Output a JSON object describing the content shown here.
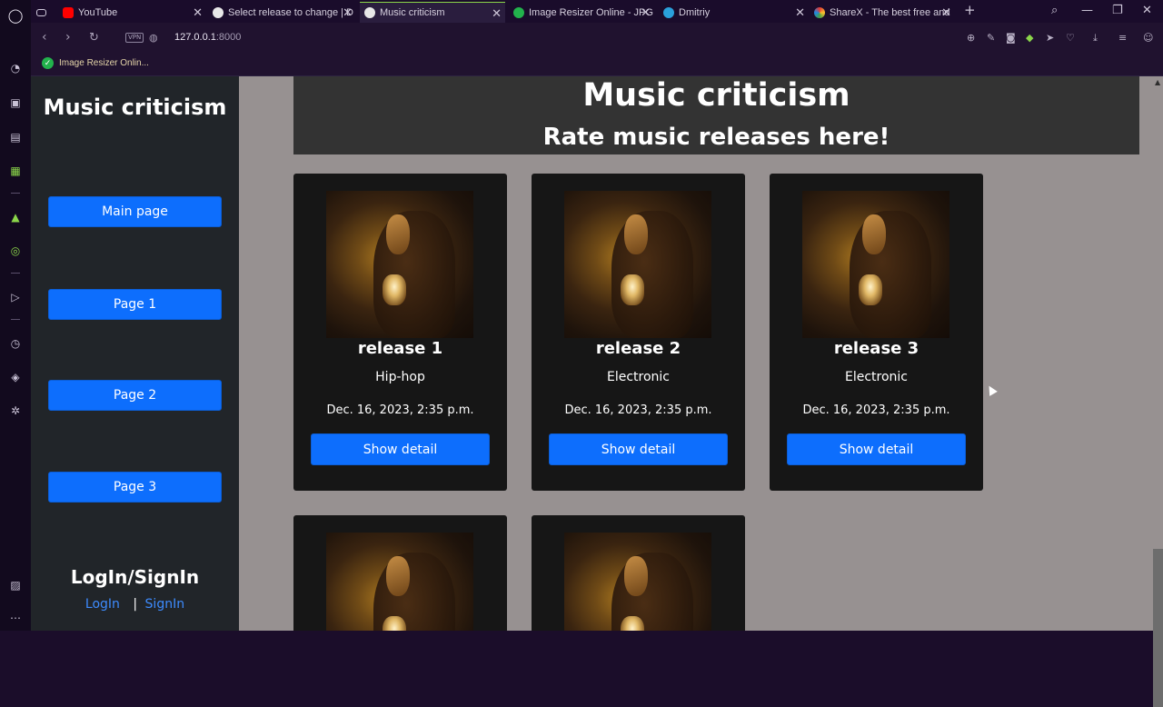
{
  "browser": {
    "tabs": [
      {
        "label": "",
        "icon": "gamepad-icon"
      },
      {
        "label": "YouTube",
        "icon": "youtube-icon"
      },
      {
        "label": "Select release to change | D",
        "icon": "globe-icon"
      },
      {
        "label": "Music criticism",
        "icon": "globe-icon",
        "active": true
      },
      {
        "label": "Image Resizer Online - JPG",
        "icon": "green-check-icon"
      },
      {
        "label": "Dmitriy",
        "icon": "telegram-icon"
      },
      {
        "label": "ShareX - The best free and",
        "icon": "sharex-icon"
      }
    ],
    "url_host": "127.0.0.1",
    "url_port": ":8000",
    "vpn_label": "VPN",
    "bookmark": "Image Resizer Onlin...",
    "accent": "#8bd64a"
  },
  "sidebar": {
    "title": "Music criticism",
    "buttons": [
      "Main page",
      "Page 1",
      "Page 2",
      "Page 3"
    ],
    "login_title": "LogIn/SignIn",
    "login_link": "LogIn",
    "separator": "|",
    "signin_link": "SignIn"
  },
  "banner": {
    "title": "Music criticism",
    "subtitle": "Rate music releases here!"
  },
  "releases": [
    {
      "name": "release 1",
      "genre": "Hip-hop",
      "date": "Dec. 16, 2023, 2:35 p.m.",
      "button": "Show detail"
    },
    {
      "name": "release 2",
      "genre": "Electronic",
      "date": "Dec. 16, 2023, 2:35 p.m.",
      "button": "Show detail"
    },
    {
      "name": "release 3",
      "genre": "Electronic",
      "date": "Dec. 16, 2023, 2:35 p.m.",
      "button": "Show detail"
    }
  ],
  "colors": {
    "primary_button": "#0d6efd",
    "sidebar_bg": "#212529",
    "page_bg": "#979191",
    "card_bg": "#161616"
  }
}
